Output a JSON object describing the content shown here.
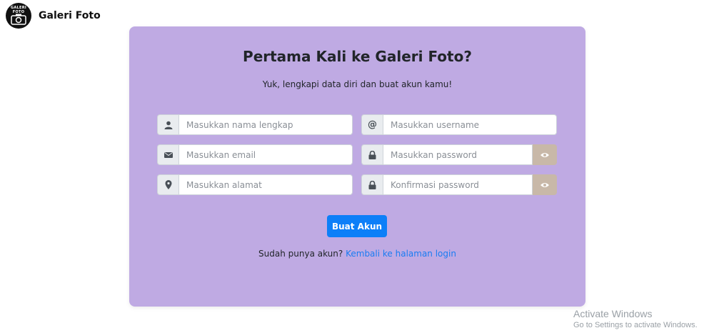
{
  "brand": {
    "logo_text": "GALERI FOTO",
    "name": "Galeri Foto"
  },
  "card": {
    "title": "Pertama Kali ke Galeri Foto?",
    "subtitle": "Yuk, lengkapi data diri dan buat akun kamu!"
  },
  "form": {
    "fullname": {
      "icon": "user-icon",
      "placeholder": "Masukkan nama lengkap"
    },
    "username": {
      "icon": "at-icon",
      "addon": "@",
      "placeholder": "Masukkan username"
    },
    "email": {
      "icon": "envelope-icon",
      "placeholder": "Masukkan email"
    },
    "password": {
      "icon": "lock-icon",
      "placeholder": "Masukkan password",
      "toggle_icon": "eye-icon"
    },
    "address": {
      "icon": "map-pin-icon",
      "placeholder": "Masukkan alamat"
    },
    "confirm_password": {
      "icon": "lock-icon",
      "placeholder": "Konfirmasi password",
      "toggle_icon": "eye-icon"
    },
    "submit_label": "Buat Akun"
  },
  "login_prompt": {
    "text": "Sudah punya akun?",
    "link": "Kembali ke halaman login"
  },
  "watermark": {
    "line1": "Activate Windows",
    "line2": "Go to Settings to activate Windows."
  },
  "colors": {
    "card": "#bfaae3",
    "button": "#0d7ff8",
    "link": "#1a7cf2",
    "eye_toggle": "#c8b8a8"
  }
}
